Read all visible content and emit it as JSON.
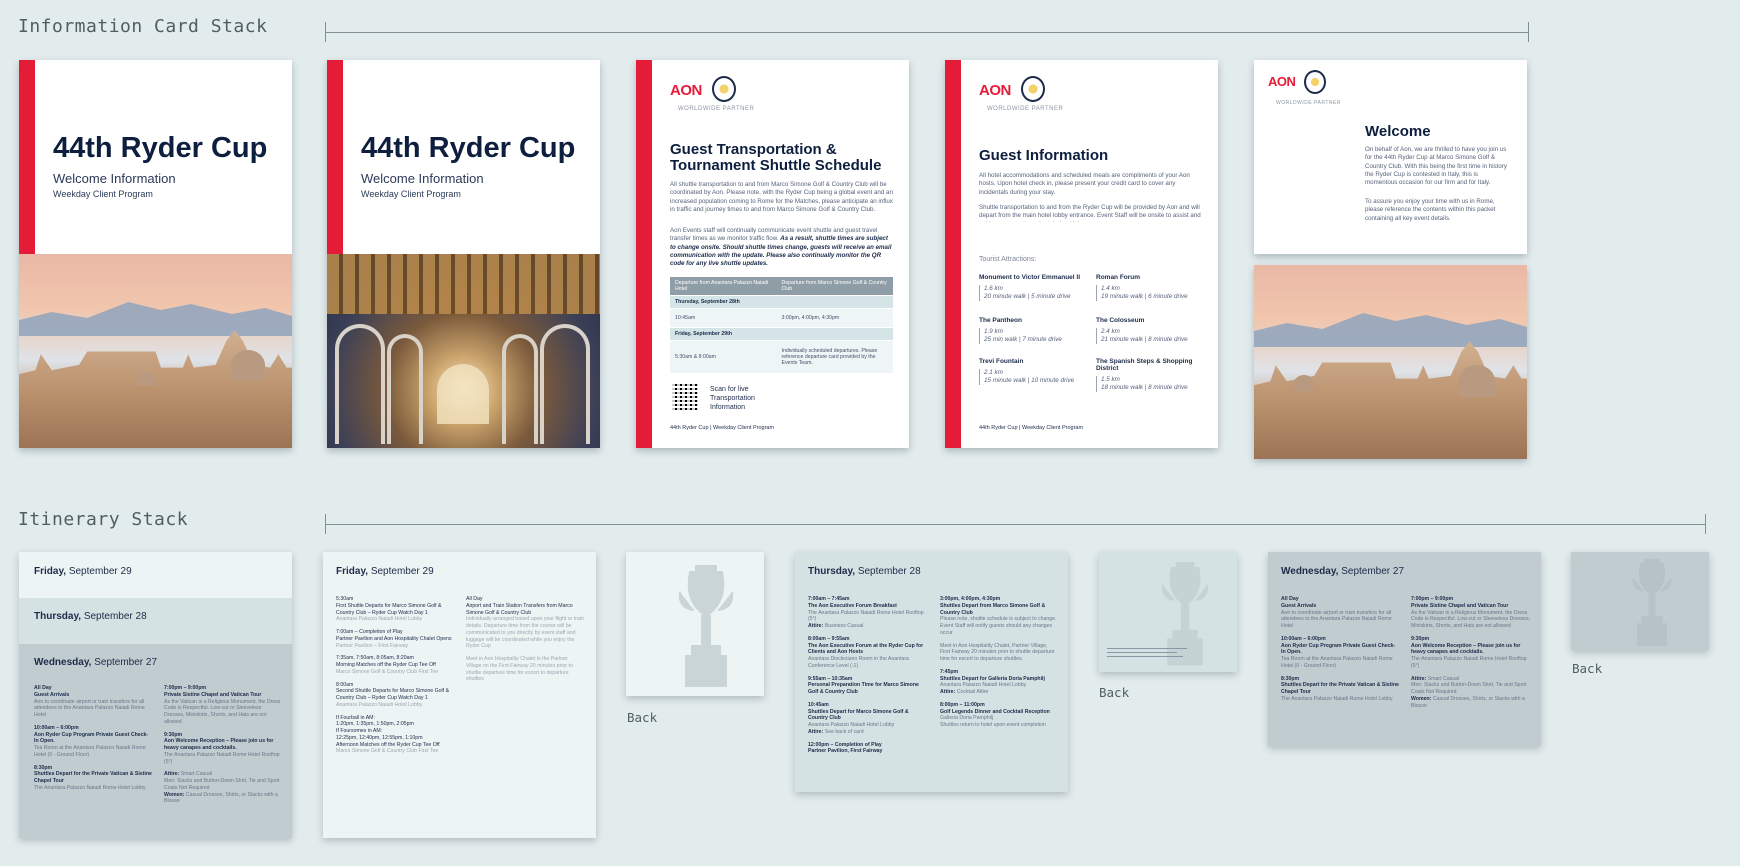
{
  "sections": {
    "info_title": "Information Card Stack",
    "itinerary_title": "Itinerary Stack"
  },
  "cover": {
    "title": "44th Ryder Cup",
    "subtitle": "Welcome Information",
    "program": "Weekday Client Program"
  },
  "brand": {
    "aon": "AON",
    "partner": "WORLDWIDE PARTNER"
  },
  "transport": {
    "title": "Guest Transportation & Tournament Shuttle Schedule",
    "p1": "All shuttle transportation to and from Marco Simone Golf & Country Club will be coordinated by Aon. Please note, with the Ryder Cup being a global event and an increased population coming to Rome for the Matches, please anticipate an influx in traffic and journey times to and from Marco Simone Golf & Country Club.",
    "p2a": "Aon Events staff will continually communicate event shuttle and guest travel transfer times as we monitor traffic flow.",
    "p2b": "As a result, shuttle times are subject to change onsite. Should shuttle times change, guests will receive an email communication with the update. Please also continually monitor the QR code for any live shuttle updates.",
    "col1": "Departure from Anantara Palazzo Naiadi Hotel",
    "col2": "Departure from Marco Simone Golf & Country Club",
    "day1": "Thursday, September 28th",
    "day1_a": "10:45am",
    "day1_b": "3:00pm, 4:00pm, 4:30pm",
    "day2": "Friday, September 29th",
    "day2_a": "5:30am & 8:00am",
    "day2_b": "Individually scheduled departures. Please reference departure card provided by the Events Team.",
    "qr_text": "Scan for live Transportation Information",
    "footer": "44th Ryder Cup | Weekday Client Program"
  },
  "guest_info": {
    "title": "Guest Information",
    "p1": "All hotel accommodations and scheduled meals are compliments of your Aon hosts. Upon hotel check in, please present your credit card to cover any incidentals during your stay.",
    "p2": "Shuttle transportation to and from the Ryder Cup will be provided by Aon and will depart from the main hotel lobby entrance. Event Staff will be onsite to assist and guide guests to the scheduled vehicles.",
    "attractions_label": "Tourist Attractions:",
    "attractions": [
      {
        "name": "Monument to Victor Emmanuel II",
        "dist": "1.6 km",
        "time": "20 minute walk | 5 minute drive"
      },
      {
        "name": "Roman Forum",
        "dist": "1.4 km",
        "time": "19 minute walk | 6 minute drive"
      },
      {
        "name": "The Pantheon",
        "dist": "1.9 km",
        "time": "25 min walk | 7 minute drive"
      },
      {
        "name": "The Colosseum",
        "dist": "2.4 km",
        "time": "21 minute walk | 8 minute drive"
      },
      {
        "name": "Trevi Fountain",
        "dist": "2.1 km",
        "time": "15 minute walk | 10 minute drive"
      },
      {
        "name": "The Spanish Steps & Shopping District",
        "dist": "1.5 km",
        "time": "18 minute walk | 8 minute drive"
      }
    ],
    "footer": "44th Ryder Cup | Weekday Client Program"
  },
  "welcome": {
    "title": "Welcome",
    "p1": "On behalf of Aon, we are thrilled to have you join us for the 44th Ryder Cup at Marco Simone Golf & Country Club. With this being the first time in history the Ryder Cup is contested in Italy, this is momentous occasion for our firm and for Italy.",
    "p2": "To assure you enjoy your time with us in Rome, please reference the contents within this packet containing all key event details."
  },
  "itinerary": {
    "fri": {
      "day": "Friday,",
      "date": "September 29"
    },
    "thu": {
      "day": "Thursday,",
      "date": "September 28"
    },
    "wed": {
      "day": "Wednesday,",
      "date": "September 27"
    },
    "back": "Back",
    "wed_events_left": [
      {
        "time": "All Day",
        "name": "Guest Arrivals",
        "loc": "Aon to coordinate airport or train transfers for all attendees to the Anantara Palazzo Naiadi Rome Hotel"
      },
      {
        "time": "10:00am – 6:00pm",
        "name": "Aon Ryder Cup Program Private Guest Check-In Open.",
        "loc": "Tea Room at the Anantara Palazzo Naiadi Rome Hotel (0 - Ground Floor)"
      },
      {
        "time": "8:30pm",
        "name": "Shuttles Depart for the Private Vatican & Sistine Chapel Tour",
        "loc": "The Anantara Palazzo Naiadi Rome Hotel Lobby"
      }
    ],
    "wed_events_right": [
      {
        "time": "7:00pm – 9:00pm",
        "name": "Private Sistine Chapel and Vatican Tour",
        "loc": "As the Vatican is a Religious Monument, the Dress Code is Respectful. Low-cut or Sleeveless Dresses, Miniskirts, Shorts, and Hats are not allowed"
      },
      {
        "time": "9:30pm",
        "name": "Aon Welcome Reception – Please join us for heavy canapes and cocktails.",
        "loc": "The Anantara Palazzo Naiadi Rome Hotel Rooftop (5°)"
      },
      {
        "time": "Attire:",
        "name": "Smart Casual",
        "loc": "Men: Slacks and Button-Down Shirt, Tie and Sport Coats Not Required"
      },
      {
        "time": "Women:",
        "name": "Casual Dresses, Shirts, or Slacks with a Blouse",
        "loc": ""
      }
    ],
    "fri_events_left": [
      {
        "time": "5:30am",
        "name": "First Shuttle Departs for Marco Simone Golf & Country Club – Ryder Cup Watch Day 1",
        "loc": "Anantara Palazzo Naiadi Hotel Lobby"
      },
      {
        "time": "7:00am – Completion of Play",
        "name": "Partner Pavilion and Aon Hospitality Chalet Opens",
        "loc": "Partner Pavilion – First Fairway"
      },
      {
        "time": "7:35am, 7:50am, 8:05am, 8:20am",
        "name": "Morning Matches off the Ryder Cup Tee Off",
        "loc": "Marco Simone Golf & Country Club First Tee"
      },
      {
        "time": "8:00am",
        "name": "Second Shuttle Departs for Marco Simone Golf & Country Club – Ryder Cup Watch Day 1",
        "loc": "Anantara Palazzo Naiadi Hotel Lobby"
      },
      {
        "time": "If Fourball in AM:",
        "name": "1:20pm, 1:35pm, 1:50pm, 2:05pm",
        "loc": ""
      },
      {
        "time": "If Foursomes in AM:",
        "name": "12:25pm, 12:40pm, 12:55pm, 1:10pm",
        "loc": "Afternoon Matches off the Ryder Cup Tee Off"
      },
      {
        "time": "",
        "name": "",
        "loc": "Marco Simone Golf & Country Club First Tee"
      }
    ],
    "fri_events_right": [
      {
        "time": "All Day",
        "name": "Airport and Train Station Transfers from Marco Simone Golf & Country Club",
        "loc": "Individually arranged based upon your flight or train details. Departure time from the course will be communicated to you directly by event staff and luggage will be coordinated while you enjoy the Ryder Cup"
      },
      {
        "time": "",
        "name": "",
        "loc": "Meet in Aon Hospitality Chalet in the Partner Village on the First Fairway 20 minutes prior to shuttle departure time for escort to departure shuttles"
      }
    ],
    "thu_events_left": [
      {
        "time": "7:00am – 7:45am",
        "name": "The Aon Executive Forum Breakfast",
        "loc": "The Anantara Palazzo Naiadi Rome Hotel Rooftop (5°)"
      },
      {
        "time": "Attire:",
        "name": "Business Casual",
        "loc": ""
      },
      {
        "time": "8:00am – 9:55am",
        "name": "The Aon Executive Forum at the Ryder Cup for Clients and Aon Hosts",
        "loc": "Anantara Diocleziano Room in the Anantara Conference Level (-1)"
      },
      {
        "time": "9:55am – 10:35am",
        "name": "Personal Preparation Time for Marco Simone Golf & Country Club",
        "loc": ""
      },
      {
        "time": "10:45am",
        "name": "Shuttles Depart for Marco Simone Golf & Country Club",
        "loc": "Anantara Palazzo Naiadi Hotel Lobby"
      },
      {
        "time": "Attire:",
        "name": "See back of card",
        "loc": ""
      },
      {
        "time": "12:00pm – Completion of Play",
        "name": "Partner Pavilion, First Fairway",
        "loc": ""
      }
    ],
    "thu_events_right": [
      {
        "time": "3:00pm, 4:00pm, 4:30pm",
        "name": "Shuttles Depart from Marco Simone Golf & Country Club",
        "loc": "Please note, shuttle schedule is subject to change. Event Staff will notify guests should any changes occur"
      },
      {
        "time": "",
        "name": "",
        "loc": "Meet in Aon Hospitality Chalet, Partner Village, First Fairway 20 minutes prior to shuttle departure time for escort to departure shuttles."
      },
      {
        "time": "7:45pm",
        "name": "Shuttles Depart for Galleria Doria Pamphilj",
        "loc": "Anantara Palazzo Naiadi Hotel Lobby"
      },
      {
        "time": "Attire:",
        "name": "Cocktail Attire",
        "loc": ""
      },
      {
        "time": "8:00pm – 11:00pm",
        "name": "Golf Legends Dinner and Cocktail Reception",
        "loc": "Galleria Doria Pamphilj"
      },
      {
        "time": "",
        "name": "",
        "loc": "Shuttles return to hotel upon event completion"
      }
    ]
  },
  "colors": {
    "bg": "#e3eced",
    "accent_red": "#e41c38",
    "navy": "#0e1e3e"
  }
}
